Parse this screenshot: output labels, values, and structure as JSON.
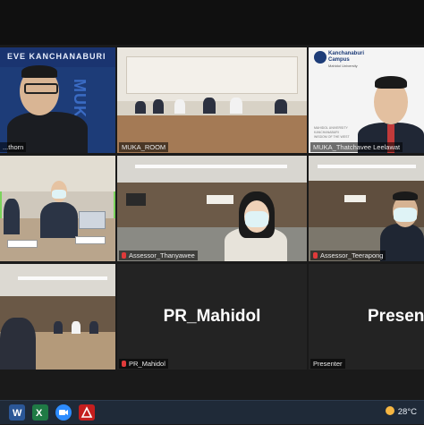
{
  "tiles": [
    {
      "id": "t1",
      "label": "...thorn",
      "banner": "EVE KANCHANABURI",
      "banner_vertical": "MUKA",
      "speaking": false
    },
    {
      "id": "t2",
      "label": "MUKA_ROOM",
      "speaking": false
    },
    {
      "id": "t3",
      "label": "MUKA_Thatchavee Leelawat",
      "campus_title": "Kanchanaburi Campus",
      "campus_sub": "Mahidol University",
      "wall_text": "MAHIDOL UNIVERSITY KANCHANABURI WISDOM OF THE WEST",
      "muted": false
    },
    {
      "id": "t4",
      "label": "",
      "speaking": true
    },
    {
      "id": "t5",
      "label": "Assessor_Thanyawee",
      "muted": true
    },
    {
      "id": "t6",
      "label": "Assessor_Teerapong",
      "muted": true
    },
    {
      "id": "t7",
      "label": "",
      "speaking": false
    },
    {
      "id": "t8",
      "label": "PR_Mahidol",
      "big_name": "PR_Mahidol",
      "muted": true
    },
    {
      "id": "t9",
      "label": "Presenter",
      "big_name": "Present",
      "muted": false
    }
  ],
  "taskbar": {
    "icons": [
      "word-icon",
      "excel-icon",
      "zoom-icon",
      "acrobat-icon"
    ],
    "weather_temp": "28°C"
  },
  "colors": {
    "speaker_outline": "#7bd35b",
    "muted": "#e03a3a",
    "taskbar": "#1f2a38"
  }
}
